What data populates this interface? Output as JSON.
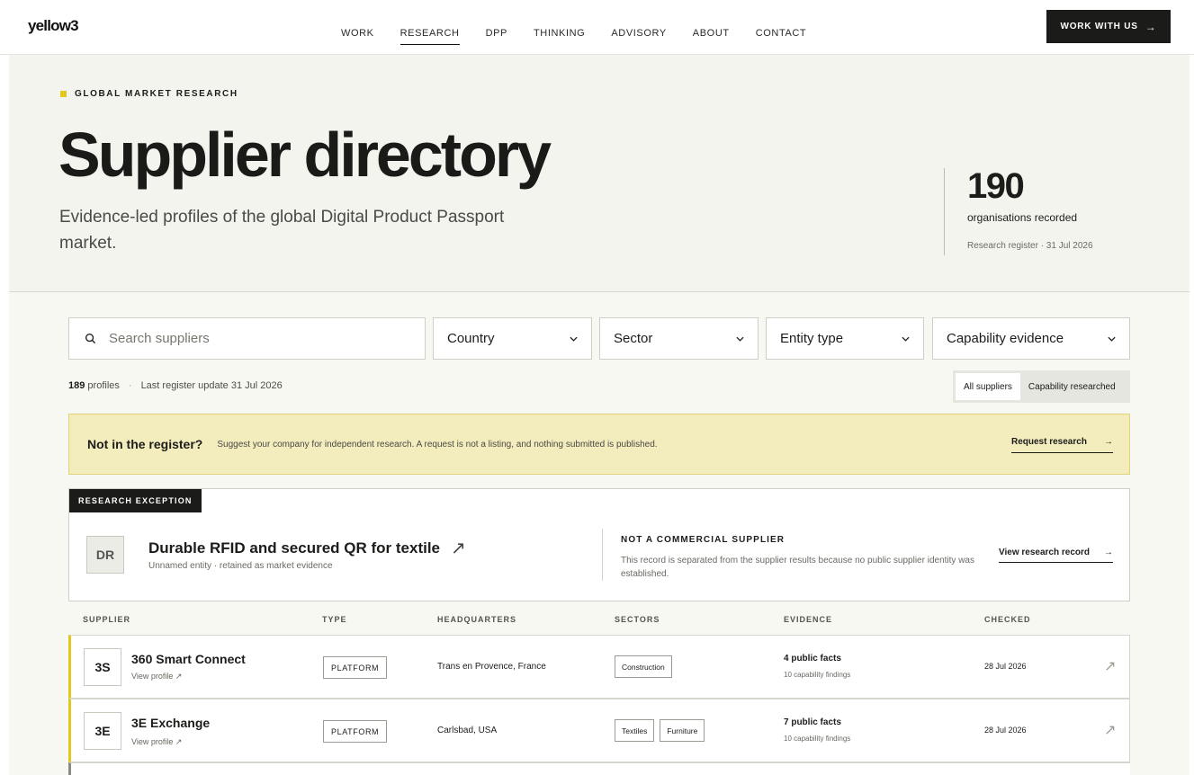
{
  "logo": "yellow3",
  "nav": [
    "WORK",
    "RESEARCH",
    "DPP",
    "THINKING",
    "ADVISORY",
    "ABOUT",
    "CONTACT"
  ],
  "cta": {
    "label": "WORK WITH US",
    "arrow": "→"
  },
  "hero": {
    "eyebrow": "GLOBAL MARKET RESEARCH",
    "title": "Supplier directory",
    "lead": "Evidence-led profiles of the global Digital Product Passport market.",
    "stat_value": "190",
    "stat_label": "organisations recorded",
    "stat_sub": "Research register · 31 Jul 2026"
  },
  "filters": {
    "search_placeholder": "Search suppliers",
    "country": "Country",
    "sector": "Sector",
    "entity": "Entity type",
    "capability": "Capability evidence"
  },
  "meta": {
    "count": "189",
    "count_label": "profiles",
    "dot": "·",
    "updated": "Last register update 31 Jul 2026"
  },
  "segmented": {
    "all": "All suppliers",
    "researched": "Capability researched"
  },
  "banner": {
    "title": "Not in the register?",
    "desc": "Suggest your company for independent research. A request is not a listing, and nothing submitted is published.",
    "link": "Request research",
    "arrow": "→"
  },
  "exception": {
    "tag": "RESEARCH EXCEPTION",
    "initials": "DR",
    "name": "Durable RFID and secured QR for textile",
    "name_icon": "↗",
    "sub": "Unnamed entity · retained as market evidence",
    "notice_title": "NOT A COMMERCIAL SUPPLIER",
    "notice_desc": "This record is separated from the supplier results because no public supplier identity was established.",
    "link": "View research record",
    "arrow": "→"
  },
  "table": {
    "headers": [
      "SUPPLIER",
      "TYPE",
      "HEADQUARTERS",
      "SECTORS",
      "EVIDENCE",
      "CHECKED"
    ],
    "rows": [
      {
        "initials": "3S",
        "name": "360 Smart Connect",
        "view": "View profile ↗",
        "type": "PLATFORM",
        "hq": "Trans en Provence, France",
        "sectors": [
          "Construction"
        ],
        "facts": "4 public facts",
        "findings": "10 capability findings",
        "checked": "28 Jul 2026",
        "arrow": "↗"
      },
      {
        "initials": "3E",
        "name": "3E Exchange",
        "view": "View profile ↗",
        "type": "PLATFORM",
        "hq": "Carlsbad, USA",
        "sectors": [
          "Textiles",
          "Furniture"
        ],
        "facts": "7 public facts",
        "findings": "10 capability findings",
        "checked": "28 Jul 2026",
        "arrow": "↗"
      }
    ]
  },
  "colors": {
    "accent": "#e2c81e",
    "dark": "#1b1b19",
    "banner": "#f3ecbd",
    "hero_bg": "#f4f4ef"
  }
}
